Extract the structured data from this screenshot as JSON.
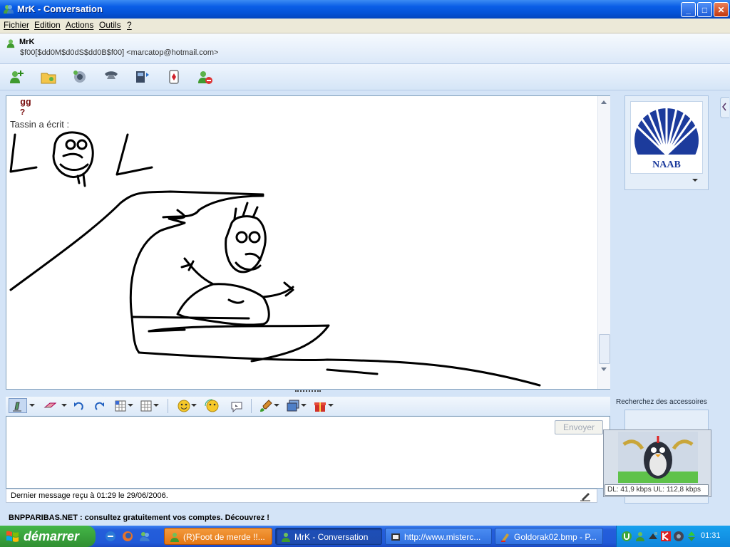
{
  "window": {
    "title": "MrK - Conversation",
    "min": "_",
    "max": "□",
    "close": "✕"
  },
  "menu": {
    "items": [
      "Fichier",
      "Edition",
      "Actions",
      "Outils",
      "?"
    ]
  },
  "contact": {
    "name": "MrK",
    "status_line": "$f00[$dd0M$d0dS$dd0B$f00] <marcatop@hotmail.com>"
  },
  "toolbar": {
    "icons": [
      "invite-contact-icon",
      "send-files-icon",
      "video-icon",
      "phone-icon",
      "activities-icon",
      "games-icon",
      "block-icon"
    ]
  },
  "messages": {
    "line1": "gg",
    "line2": "?",
    "author_line": "Tassin a écrit :"
  },
  "logo": {
    "text": "NAAB"
  },
  "input": {
    "send_label": "Envoyer"
  },
  "status": {
    "text": "Dernier message reçu à 01:29 le 29/06/2006."
  },
  "ad": {
    "text": "BNPPARIBAS.NET : consultez gratuitement vos comptes. Découvrez !"
  },
  "accessories": {
    "label": "Recherchez des accessoires",
    "speed": "DL: 41,9 kbps  UL: 112,8 kbps"
  },
  "taskbar": {
    "start": "démarrer",
    "tasks": [
      "(R)Foot de merde !!...",
      "MrK - Conversation",
      "http://www.misterc...",
      "Goldorak02.bmp - P..."
    ],
    "clock": "01:31"
  }
}
